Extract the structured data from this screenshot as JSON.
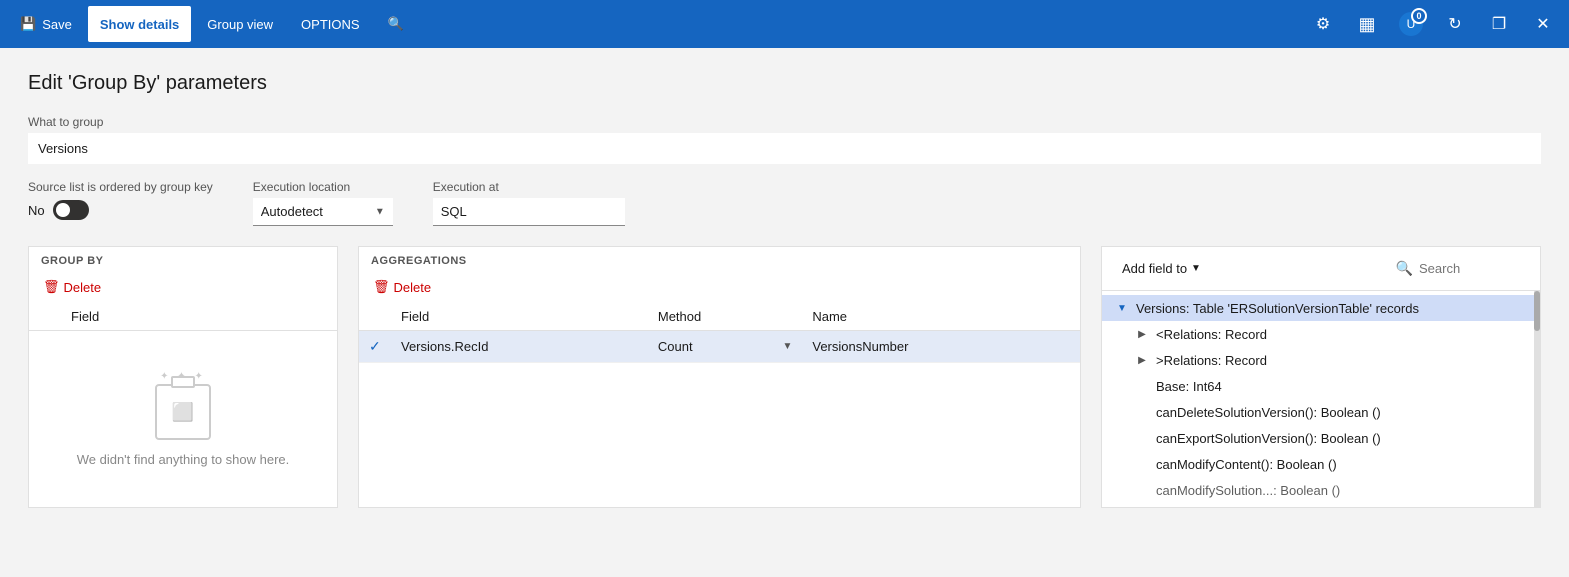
{
  "titlebar": {
    "save_label": "Save",
    "show_details_label": "Show details",
    "group_view_label": "Group view",
    "options_label": "OPTIONS",
    "search_icon": "🔍",
    "settings_icon": "⚙",
    "office_icon": "▦",
    "user_icon": "👤",
    "badge_count": "0",
    "refresh_icon": "↻",
    "restore_icon": "❐",
    "close_icon": "✕"
  },
  "page": {
    "title": "Edit 'Group By' parameters",
    "what_to_group_label": "What to group",
    "what_to_group_value": "Versions",
    "source_ordered_label": "Source list is ordered by group key",
    "toggle_value": "No",
    "execution_location_label": "Execution location",
    "execution_location_value": "Autodetect",
    "execution_at_label": "Execution at",
    "execution_at_value": "SQL"
  },
  "group_by": {
    "section_label": "GROUP BY",
    "delete_label": "Delete",
    "field_col": "Field",
    "empty_message": "We didn't find anything to show here."
  },
  "aggregations": {
    "section_label": "AGGREGATIONS",
    "delete_label": "Delete",
    "field_col": "Field",
    "method_col": "Method",
    "name_col": "Name",
    "row": {
      "field": "Versions.RecId",
      "method": "Count",
      "name": "VersionsNumber"
    }
  },
  "field_panel": {
    "add_field_label": "Add field to",
    "search_placeholder": "Search",
    "tree": [
      {
        "label": "Versions: Table 'ERSolutionVersionTable' records",
        "level": 0,
        "expanded": true,
        "highlighted": true
      },
      {
        "label": "<Relations: Record",
        "level": 1,
        "expanded": false,
        "highlighted": false
      },
      {
        "label": ">Relations: Record",
        "level": 1,
        "expanded": false,
        "highlighted": false
      },
      {
        "label": "Base: Int64",
        "level": 1,
        "expanded": false,
        "highlighted": false
      },
      {
        "label": "canDeleteSolutionVersion(): Boolean ()",
        "level": 1,
        "expanded": false,
        "highlighted": false
      },
      {
        "label": "canExportSolutionVersion(): Boolean ()",
        "level": 1,
        "expanded": false,
        "highlighted": false
      },
      {
        "label": "canModifyContent(): Boolean ()",
        "level": 1,
        "expanded": false,
        "highlighted": false
      },
      {
        "label": "canModifySolution...: Boolean ()",
        "level": 1,
        "expanded": false,
        "highlighted": false
      }
    ]
  }
}
